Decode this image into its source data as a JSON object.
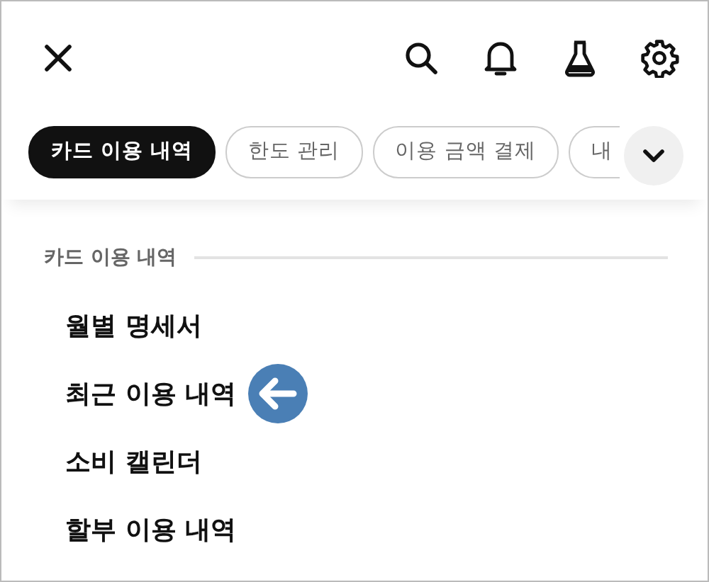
{
  "tabs": [
    {
      "label": "카드 이용 내역",
      "selected": true
    },
    {
      "label": "한도 관리",
      "selected": false
    },
    {
      "label": "이용 금액 결제",
      "selected": false
    },
    {
      "label": "내",
      "selected": false
    }
  ],
  "section": {
    "title": "카드 이용 내역",
    "items": [
      {
        "label": "월별 명세서",
        "pointed": false
      },
      {
        "label": "최근 이용 내역",
        "pointed": true
      },
      {
        "label": "소비 캘린더",
        "pointed": false
      },
      {
        "label": "할부 이용 내역",
        "pointed": false
      }
    ]
  }
}
